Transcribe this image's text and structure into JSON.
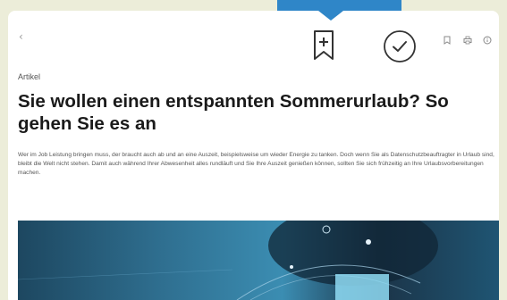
{
  "toolbar": {
    "back_icon": "chevron-left-icon",
    "bookmark_add_icon": "bookmark-plus-icon",
    "done_icon": "check-circle-icon",
    "small_icons": [
      "bookmark-icon",
      "printer-icon",
      "info-icon"
    ]
  },
  "article": {
    "category": "Artikel",
    "title": "Sie wollen einen entspannten Sommerurlaub? So gehen Sie es an",
    "lead": "Wer im Job Leistung bringen muss, der braucht auch ab und an eine Auszeit, beispielsweise um wieder Energie zu tanken. Doch wenn Sie als Datenschutzbeauftragter in Urlaub sind, bleibt die Welt nicht stehen. Damit auch während Ihrer Abwesenheit alles rundläuft und Sie Ihre Auszeit genießen können, sollten Sie sich frühzeitig an Ihre Urlaubsvorbereitungen machen."
  },
  "colors": {
    "background": "#ecedd9",
    "accent": "#2f86c8",
    "text": "#1a1a1a"
  }
}
